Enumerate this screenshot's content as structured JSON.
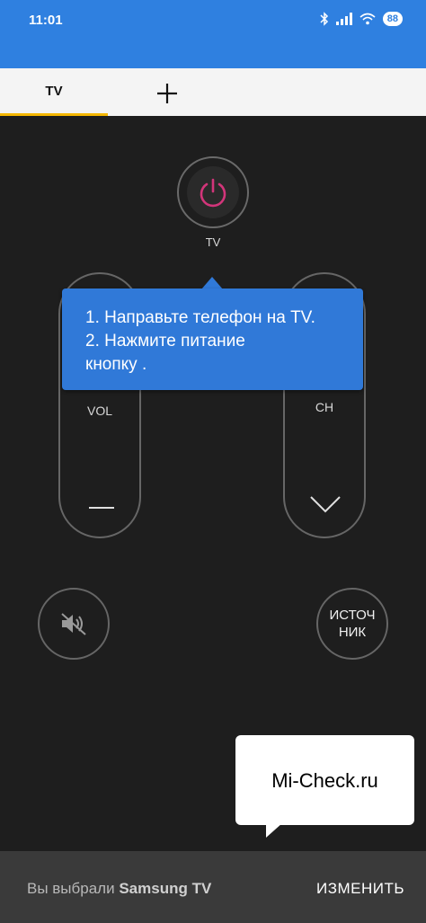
{
  "status_bar": {
    "time": "11:01",
    "battery": "88",
    "background": "#2f80e0"
  },
  "tabs": {
    "active": "TV",
    "add_label": "+"
  },
  "accent": "#f5b800",
  "remote": {
    "power_label": "TV",
    "vol_label": "VOL",
    "ch_label": "CH",
    "source_line1": "ИСТОЧ",
    "source_line2": "НИК"
  },
  "tooltip": {
    "line1": "1. Направьте телефон на TV.",
    "line2": "2. Нажмите питание",
    "line3": "кнопку ."
  },
  "watermark": "Mi-Check.ru",
  "bottom": {
    "selected_prefix": "Вы выбрали",
    "device": "Samsung TV",
    "change_label": "ИЗМЕНИТЬ"
  },
  "icons": [
    "bluetooth-icon",
    "signal-icon",
    "wifi-icon",
    "battery-icon",
    "plus-icon",
    "power-icon",
    "minus-icon",
    "chevron-down-icon",
    "mute-icon"
  ]
}
